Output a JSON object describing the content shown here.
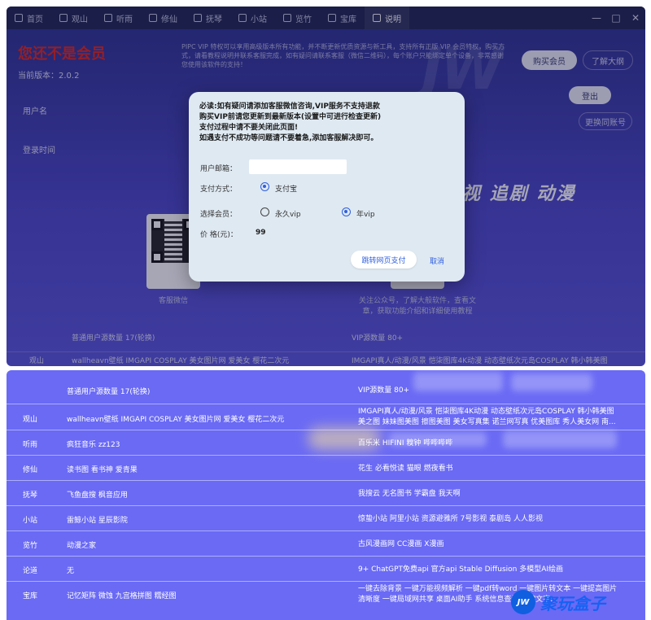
{
  "top": {
    "tabs": [
      {
        "label": "首页",
        "icon": "home-icon"
      },
      {
        "label": "观山",
        "icon": "film-icon"
      },
      {
        "label": "听雨",
        "icon": "music-icon"
      },
      {
        "label": "修仙",
        "icon": "book-icon"
      },
      {
        "label": "抚琴",
        "icon": "folder-icon"
      },
      {
        "label": "小站",
        "icon": "grid-icon"
      },
      {
        "label": "览竹",
        "icon": "image-icon"
      },
      {
        "label": "宝库",
        "icon": "server-icon"
      },
      {
        "label": "说明",
        "icon": "info-icon"
      }
    ],
    "window_controls": {
      "minimize": "—",
      "maximize": "□",
      "close": "✕"
    },
    "status_title": "您还不是会员",
    "version": "当前版本：2.0.2",
    "notice": "PIPC VIP 特权可以享用高级版本所有功能，并不断更新优质资源与新工具，支持所有正版 VIP 会员特权，购买方式，请看教程说明并联系客服完成，如有疑问请联系客服（微信二维码），每个账户只能绑定单个设备，非常感谢您使用该软件的支持！",
    "watermark": "JW",
    "buy_button": "购买会员",
    "learn_button": "了解大纲",
    "logout_button": "登出",
    "unbind_button": "更换同账号",
    "username_label": "用户名",
    "login_time_label": "登录时间",
    "banner": "视 追剧 动漫",
    "qr_left_caption": "客服微信",
    "qr_right_caption": "关注公众号，了解大般软件，查看文章，获取功能介绍和详细使用教程",
    "table_head_normal": "普通用户源数量 17(轮换)",
    "table_head_vip": "VIP源数量 80+",
    "peek_row": {
      "name": "观山",
      "normal": "wallheavn壁纸 IMGAPI COSPLAY 美女图片网 爱美女 樱花二次元",
      "vip": "IMGAPI真人/动漫/风景 恺柒图库4K动漫 动态壁纸次元岛COSPLAY 韩小韩美图"
    }
  },
  "modal": {
    "notice_lines": [
      "必读:如有疑问请添加客服微信咨询,VIP服务不支持退款",
      "购买VIP前请您更新到最新版本(设置中可进行检查更新)",
      "支付过程中请不要关闭此页面!",
      "如遇支付不成功等问题请不要着急,添加客服解决即可。"
    ],
    "email_label": "用户邮箱：",
    "email_value": "",
    "payment_label": "支付方式：",
    "payment_option": "支付宝",
    "member_label": "选择会员：",
    "member_options": [
      "永久vip",
      "年vip"
    ],
    "member_selected": "年vip",
    "price_label": "价 格(元)：",
    "price_value": "99",
    "pay_button": "跳转网页支付",
    "cancel_button": "取消"
  },
  "bottom": {
    "header": {
      "normal": "普通用户源数量 17(轮换)",
      "vip": "VIP源数量 80+"
    },
    "rows": [
      {
        "name": "观山",
        "normal": "wallheavn壁纸 IMGAPI COSPLAY 美女图片网 爱美女 樱花二次元",
        "vip": "IMGAPI真人/动漫/风景 恺柒图库4K动漫 动态壁纸次元岛COSPLAY 韩小韩美图 美之图 妹妹图美图 擦图美图 美女写真集 诺兰网写真 优美图库 秀人美女网 南..."
      },
      {
        "name": "听雨",
        "normal": "疯狂音乐 zz123",
        "vip": "百乐米 HIFINI 糗钟 哔哔哔哔"
      },
      {
        "name": "修仙",
        "normal": "读书图 看书神 爱青果",
        "vip": "花生 必看悦读 猫眼 燃夜看书"
      },
      {
        "name": "抚琴",
        "normal": "飞鱼盘搜 枫音应用",
        "vip": "我搜云 无名图书 学霸盘 我天啊"
      },
      {
        "name": "小站",
        "normal": "雷鲸小站 星辰影院",
        "vip": "惊蛰小站 阿里小站 资源避雅所 7号影视 泰剧岛 人人影视"
      },
      {
        "name": "览竹",
        "normal": "动漫之家",
        "vip": "古风漫画网 CC漫画 X漫画"
      },
      {
        "name": "论道",
        "normal": "无",
        "vip": "9+ ChatGPT免费api 官方api Stable Diffusion 多模型AI绘画"
      },
      {
        "name": "宝库",
        "normal": "记忆矩阵 微蚀 九宫格拼图 糯经图",
        "vip": "一键去除背景 一键万能视频解析 一键pdf转word 一键图片转文本 一键提高图片清晰度 一键局域网共享 桌面AI助手 系统信息查看 一键文字..."
      }
    ],
    "brand_badge": "JW",
    "brand_text": "聚玩盒子"
  }
}
